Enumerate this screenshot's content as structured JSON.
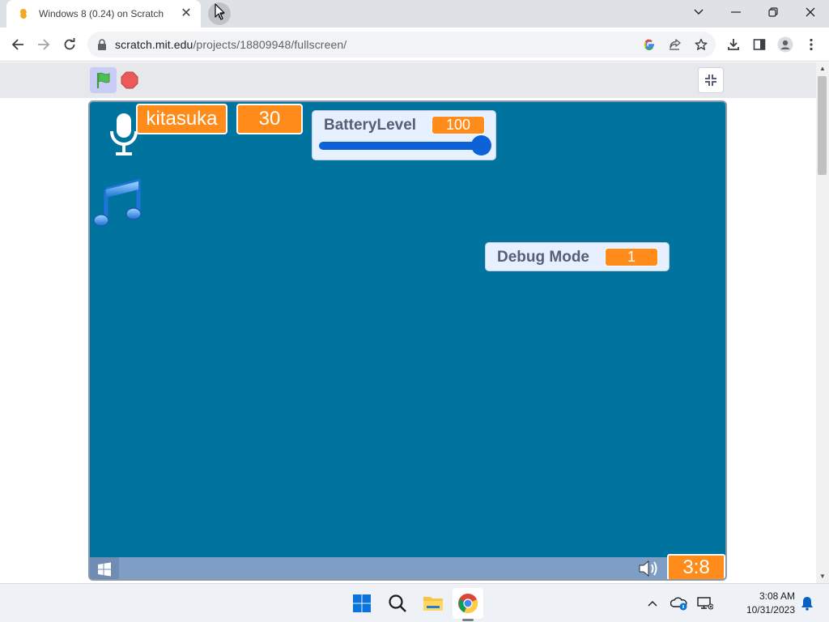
{
  "browser": {
    "tab_title": "Windows 8 (0.24) on Scratch",
    "tab_close": "✕",
    "url_host": "scratch.mit.edu",
    "url_path": "/projects/18809948/fullscreen/"
  },
  "stage": {
    "name_var": "kitasuka",
    "num_var": "30",
    "battery_label": "BatteryLevel",
    "battery_value": "100",
    "battery_slider_level": 1.0,
    "debug_label": "Debug Mode",
    "debug_value": "1",
    "clock": "3:8"
  },
  "taskbar": {
    "time": "3:08 AM",
    "date": "10/31/2023"
  },
  "colors": {
    "stage_bg": "#00739f",
    "scratch_orange": "#ff8c1a",
    "monitor_bg": "#e6f0ff",
    "slider_blue": "#0e62d8"
  },
  "icons": [
    "scratch-favicon-icon",
    "close-icon",
    "new-tab-icon",
    "chevron-down-icon",
    "minimize-icon",
    "restore-icon",
    "back-icon",
    "forward-icon",
    "reload-icon",
    "lock-icon",
    "google-icon",
    "share-icon",
    "star-icon",
    "download-icon",
    "side-panel-icon",
    "profile-icon",
    "menu-icon",
    "green-flag-icon",
    "stop-icon",
    "exit-fullscreen-icon",
    "microphone-icon",
    "music-note-icon",
    "windows-start-icon",
    "speaker-icon",
    "windows-logo-icon",
    "search-icon",
    "file-explorer-icon",
    "chrome-icon",
    "chevron-up-icon",
    "onedrive-icon",
    "display-icon",
    "notification-bell-icon"
  ]
}
